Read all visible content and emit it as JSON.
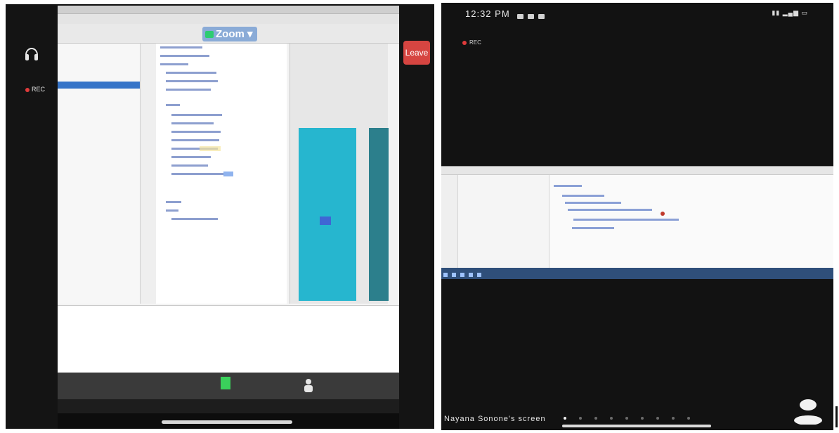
{
  "left": {
    "toolbar": {
      "zoom_label": "Zoom"
    },
    "leave_label": "Leave",
    "rec_label": "REC",
    "colors": {
      "leave": "#d64541",
      "preview_device": "#26b6cf",
      "selection": "#3574c8"
    }
  },
  "right": {
    "status": {
      "time": "12:32 PM"
    },
    "rec_label": "REC",
    "screen_owner": "Nayana Sonone's screen"
  }
}
